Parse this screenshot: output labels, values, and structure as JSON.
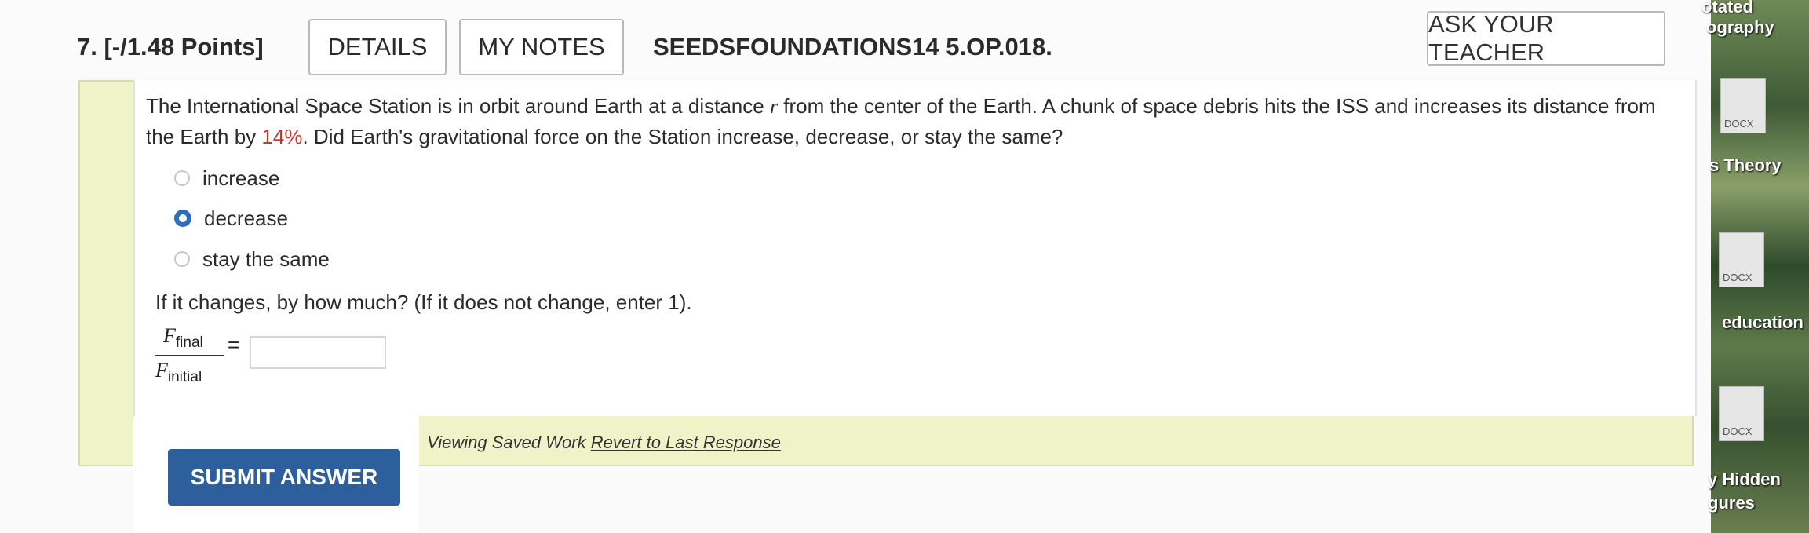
{
  "header": {
    "question_number": "7.",
    "points": "[-/1.48 Points]",
    "details_label": "DETAILS",
    "my_notes_label": "MY NOTES",
    "question_id": "SEEDSFOUNDATIONS14 5.OP.018.",
    "ask_teacher_label": "ASK YOUR TEACHER"
  },
  "question": {
    "text_part1": "The International Space Station is in orbit around Earth at a distance ",
    "var_r": "r",
    "text_part2": " from the center of the Earth. A chunk of space debris hits the ISS and increases its distance from the Earth by ",
    "percent": "14%",
    "text_part3": ". Did Earth's gravitational force on the Station increase, decrease, or stay the same?"
  },
  "options": [
    {
      "label": "increase",
      "selected": false
    },
    {
      "label": "decrease",
      "selected": true
    },
    {
      "label": "stay the same",
      "selected": false
    }
  ],
  "subquestion": "If it changes, by how much? (If it does not change, enter 1).",
  "fraction": {
    "num_var": "F",
    "num_sub": "final",
    "den_var": "F",
    "den_sub": "initial",
    "equals": "="
  },
  "answer": {
    "value": ""
  },
  "footer": {
    "submit_label": "SUBMIT ANSWER",
    "viewing_saved": "Viewing Saved Work ",
    "revert_link": "Revert to Last Response"
  },
  "desktop": {
    "labels": [
      "otated",
      "ography",
      "s Theory",
      "education",
      "y Hidden",
      "gures"
    ],
    "doc_ext": "DOCX"
  },
  "colors": {
    "accent": "#2c5f9c",
    "radio_selected": "#2a6fbd",
    "highlight_bg": "#f0f2c8",
    "percent_color": "#c0392b"
  }
}
